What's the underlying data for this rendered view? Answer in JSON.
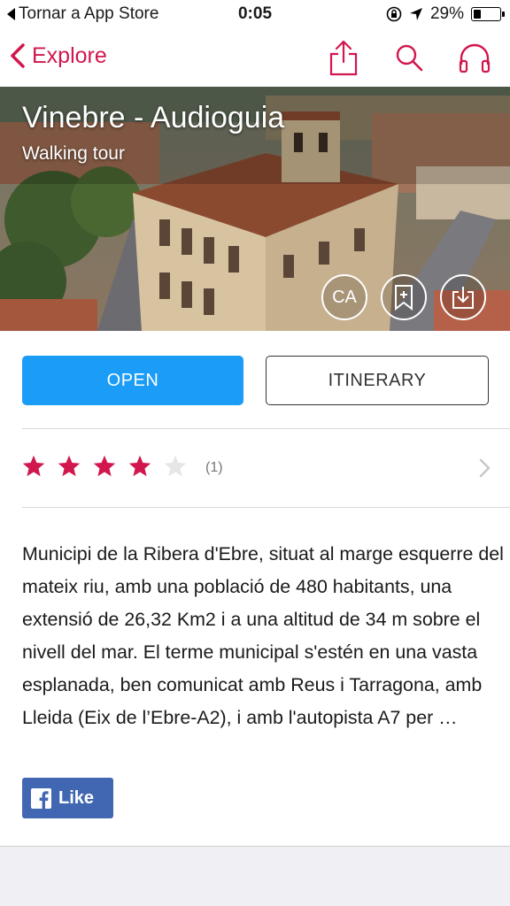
{
  "status_bar": {
    "back_app": "Tornar a App Store",
    "time": "0:05",
    "battery": "29%",
    "battery_level": 0.29
  },
  "nav": {
    "back_label": "Explore",
    "icons": [
      "share-icon",
      "search-icon",
      "headphones-icon"
    ],
    "accent_color": "#d1174d"
  },
  "hero": {
    "title": "Vinebre - Audioguia",
    "subtitle": "Walking tour",
    "language_button": "CA",
    "icons": [
      "bookmark-add-icon",
      "download-icon"
    ]
  },
  "actions": {
    "open_label": "OPEN",
    "itinerary_label": "ITINERARY",
    "open_color": "#1a9cf7"
  },
  "rating": {
    "stars": 4,
    "max_stars": 5,
    "count": "(1)",
    "star_color": "#d1174d"
  },
  "description": "Municipi de la Ribera d'Ebre, situat al marge esquerre del mateix riu, amb una població de 480 habitants, una extensió de 26,32 Km2 i a una altitud de 34 m sobre el nivell del mar. El terme municipal s'estén en una vasta esplanada, ben comunicat amb Reus i Tarragona, amb Lleida (Eix de l’Ebre-A2), i amb l'autopista A7 per …",
  "facebook": {
    "like_label": "Like",
    "color": "#4267b2"
  }
}
